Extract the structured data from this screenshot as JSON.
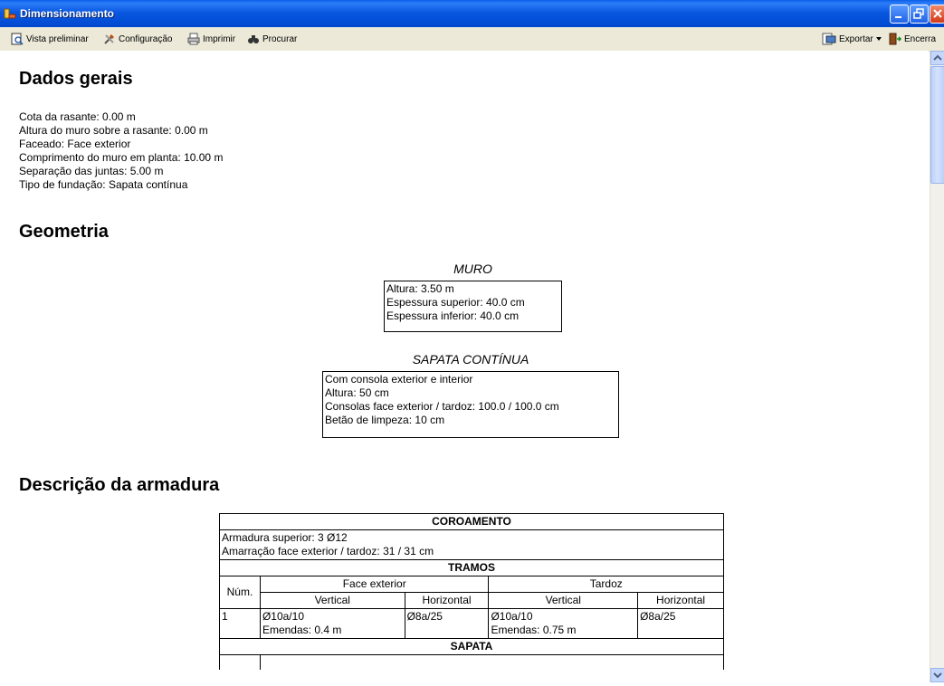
{
  "window": {
    "title": "Dimensionamento"
  },
  "toolbar": {
    "left": [
      {
        "label": "Vista preliminar",
        "icon": "preview-icon"
      },
      {
        "label": "Configuração",
        "icon": "tools-icon"
      },
      {
        "label": "Imprimir",
        "icon": "printer-icon"
      },
      {
        "label": "Procurar",
        "icon": "binoculars-icon"
      }
    ],
    "right": [
      {
        "label": "Exportar",
        "icon": "export-icon"
      },
      {
        "label": "Encerra",
        "icon": "exit-icon"
      }
    ]
  },
  "sections": {
    "dados_gerais": {
      "title": "Dados gerais",
      "lines": [
        "Cota da rasante: 0.00 m",
        "Altura do muro sobre a rasante: 0.00 m",
        "Faceado: Face exterior",
        "Comprimento do muro em planta: 10.00 m",
        "Separação das juntas: 5.00 m",
        "Tipo de fundação: Sapata contínua"
      ]
    },
    "geometria": {
      "title": "Geometria",
      "muro": {
        "caption": "MURO",
        "lines": [
          "Altura: 3.50 m",
          "Espessura superior: 40.0 cm",
          "Espessura inferior: 40.0 cm"
        ]
      },
      "sapata": {
        "caption": "SAPATA CONTÍNUA",
        "lines": [
          "Com consola exterior e interior",
          "Altura: 50 cm",
          "Consolas face exterior / tardoz: 100.0 / 100.0 cm",
          "Betão de limpeza: 10 cm"
        ]
      }
    },
    "armadura": {
      "title": "Descrição da armadura",
      "coroamento": {
        "header": "COROAMENTO",
        "lines": [
          "Armadura superior: 3 Ø12",
          "Amarração face exterior / tardoz: 31 / 31 cm"
        ]
      },
      "tramos": {
        "header": "TRAMOS",
        "col_num": "Núm.",
        "face_exterior": "Face exterior",
        "tardoz": "Tardoz",
        "vertical": "Vertical",
        "horizontal": "Horizontal",
        "row": {
          "num": "1",
          "fe_vertical": "Ø10a/10",
          "fe_emendas": "Emendas: 0.4 m",
          "fe_horizontal": "Ø8a/25",
          "td_vertical": "Ø10a/10",
          "td_emendas": "Emendas: 0.75 m",
          "td_horizontal": "Ø8a/25"
        }
      },
      "sapata_header": "SAPATA"
    }
  }
}
